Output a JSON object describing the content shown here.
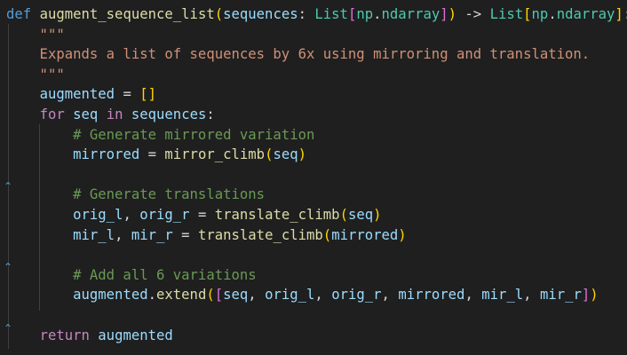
{
  "code": {
    "lines": [
      {
        "tokens": [
          {
            "t": "def",
            "c": "kw-def"
          },
          {
            "t": " ",
            "c": "punc"
          },
          {
            "t": "augment_sequence_list",
            "c": "fn"
          },
          {
            "t": "(",
            "c": "br1"
          },
          {
            "t": "sequences",
            "c": "var"
          },
          {
            "t": ": ",
            "c": "punc"
          },
          {
            "t": "List",
            "c": "type"
          },
          {
            "t": "[",
            "c": "br2"
          },
          {
            "t": "np",
            "c": "type"
          },
          {
            "t": ".",
            "c": "punc"
          },
          {
            "t": "ndarray",
            "c": "type"
          },
          {
            "t": "]",
            "c": "br2"
          },
          {
            "t": ")",
            "c": "br1"
          },
          {
            "t": " -> ",
            "c": "punc"
          },
          {
            "t": "List",
            "c": "type"
          },
          {
            "t": "[",
            "c": "br1"
          },
          {
            "t": "np",
            "c": "type"
          },
          {
            "t": ".",
            "c": "punc"
          },
          {
            "t": "ndarray",
            "c": "type"
          },
          {
            "t": "]",
            "c": "br1"
          },
          {
            "t": ":",
            "c": "punc"
          }
        ]
      },
      {
        "tokens": [
          {
            "t": "    \"\"\"",
            "c": "str"
          }
        ]
      },
      {
        "tokens": [
          {
            "t": "    Expands a list of sequences by 6x using mirroring and translation.",
            "c": "str"
          }
        ]
      },
      {
        "tokens": [
          {
            "t": "    \"\"\"",
            "c": "str"
          }
        ]
      },
      {
        "tokens": [
          {
            "t": "    ",
            "c": "punc"
          },
          {
            "t": "augmented",
            "c": "var"
          },
          {
            "t": " = ",
            "c": "punc"
          },
          {
            "t": "[]",
            "c": "br1"
          }
        ]
      },
      {
        "tokens": [
          {
            "t": "    ",
            "c": "punc"
          },
          {
            "t": "for",
            "c": "kw-ctl"
          },
          {
            "t": " ",
            "c": "punc"
          },
          {
            "t": "seq",
            "c": "var"
          },
          {
            "t": " ",
            "c": "punc"
          },
          {
            "t": "in",
            "c": "kw-ctl"
          },
          {
            "t": " ",
            "c": "punc"
          },
          {
            "t": "sequences",
            "c": "var"
          },
          {
            "t": ":",
            "c": "punc"
          }
        ]
      },
      {
        "tokens": [
          {
            "t": "        # Generate mirrored variation",
            "c": "cmt"
          }
        ]
      },
      {
        "tokens": [
          {
            "t": "        ",
            "c": "punc"
          },
          {
            "t": "mirrored",
            "c": "var"
          },
          {
            "t": " = ",
            "c": "punc"
          },
          {
            "t": "mirror_climb",
            "c": "fn"
          },
          {
            "t": "(",
            "c": "br1"
          },
          {
            "t": "seq",
            "c": "var"
          },
          {
            "t": ")",
            "c": "br1"
          }
        ]
      },
      {
        "tokens": []
      },
      {
        "tokens": [
          {
            "t": "        # Generate translations",
            "c": "cmt"
          }
        ]
      },
      {
        "tokens": [
          {
            "t": "        ",
            "c": "punc"
          },
          {
            "t": "orig_l",
            "c": "var"
          },
          {
            "t": ", ",
            "c": "punc"
          },
          {
            "t": "orig_r",
            "c": "var"
          },
          {
            "t": " = ",
            "c": "punc"
          },
          {
            "t": "translate_climb",
            "c": "fn"
          },
          {
            "t": "(",
            "c": "br1"
          },
          {
            "t": "seq",
            "c": "var"
          },
          {
            "t": ")",
            "c": "br1"
          }
        ]
      },
      {
        "tokens": [
          {
            "t": "        ",
            "c": "punc"
          },
          {
            "t": "mir_l",
            "c": "var"
          },
          {
            "t": ", ",
            "c": "punc"
          },
          {
            "t": "mir_r",
            "c": "var"
          },
          {
            "t": " = ",
            "c": "punc"
          },
          {
            "t": "translate_climb",
            "c": "fn"
          },
          {
            "t": "(",
            "c": "br1"
          },
          {
            "t": "mirrored",
            "c": "var"
          },
          {
            "t": ")",
            "c": "br1"
          }
        ]
      },
      {
        "tokens": []
      },
      {
        "tokens": [
          {
            "t": "        # Add all 6 variations",
            "c": "cmt"
          }
        ]
      },
      {
        "tokens": [
          {
            "t": "        ",
            "c": "punc"
          },
          {
            "t": "augmented",
            "c": "var"
          },
          {
            "t": ".",
            "c": "punc"
          },
          {
            "t": "extend",
            "c": "fn"
          },
          {
            "t": "(",
            "c": "br1"
          },
          {
            "t": "[",
            "c": "br2"
          },
          {
            "t": "seq",
            "c": "var"
          },
          {
            "t": ", ",
            "c": "punc"
          },
          {
            "t": "orig_l",
            "c": "var"
          },
          {
            "t": ", ",
            "c": "punc"
          },
          {
            "t": "orig_r",
            "c": "var"
          },
          {
            "t": ", ",
            "c": "punc"
          },
          {
            "t": "mirrored",
            "c": "var"
          },
          {
            "t": ", ",
            "c": "punc"
          },
          {
            "t": "mir_l",
            "c": "var"
          },
          {
            "t": ", ",
            "c": "punc"
          },
          {
            "t": "mir_r",
            "c": "var"
          },
          {
            "t": "]",
            "c": "br2"
          },
          {
            "t": ")",
            "c": "br1"
          }
        ]
      },
      {
        "tokens": []
      },
      {
        "tokens": [
          {
            "t": "    ",
            "c": "punc"
          },
          {
            "t": "return",
            "c": "kw-ctl"
          },
          {
            "t": " ",
            "c": "punc"
          },
          {
            "t": "augmented",
            "c": "var"
          }
        ]
      }
    ],
    "fold_markers": [
      "⌃",
      "⌃",
      "⌃"
    ],
    "colors": {
      "background": "#1f1f1f",
      "keyword_def": "#569cd6",
      "keyword_control": "#c586c0",
      "function": "#dcdcaa",
      "variable": "#9cdcfe",
      "type": "#4ec9b0",
      "string": "#ce9178",
      "comment": "#6a9955"
    }
  }
}
